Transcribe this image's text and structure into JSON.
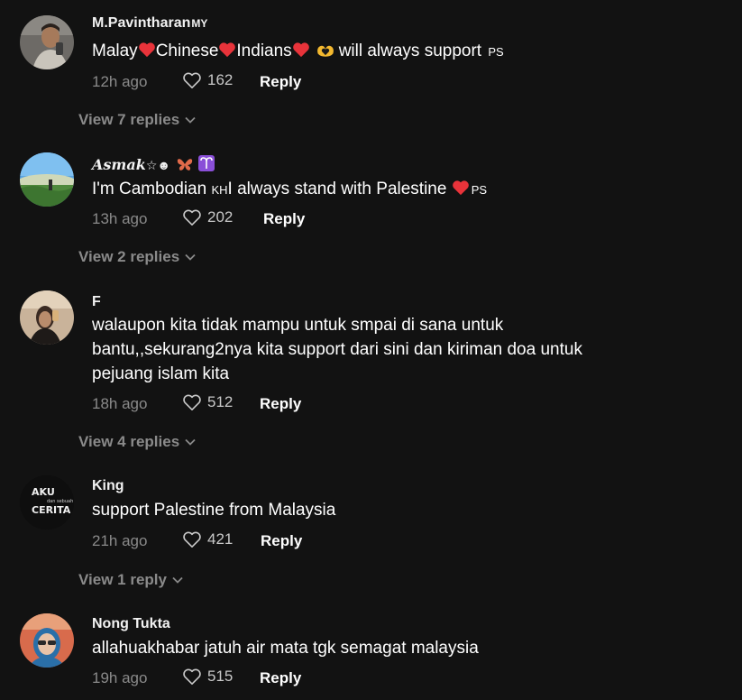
{
  "comments": [
    {
      "username": "M.Pavintharan",
      "username_flag": "MY",
      "text_parts": [
        "Malay",
        "Chinese",
        "Indians",
        "will always support",
        "PS"
      ],
      "time": "12h ago",
      "likes": "162",
      "reply_label": "Reply",
      "view_replies": "View 7 replies"
    },
    {
      "username": "Asmak",
      "username_suffix": "☆☻",
      "text_parts": [
        "I'm Cambodian",
        "KH",
        "I always stand with Palestine",
        "PS"
      ],
      "time": "13h ago",
      "likes": "202",
      "reply_label": "Reply",
      "view_replies": "View 2 replies"
    },
    {
      "username": "F",
      "text": "walaupon kita tidak mampu untuk smpai di sana untuk bantu,,sekurang2nya kita support dari sini dan kiriman doa untuk pejuang islam kita",
      "time": "18h ago",
      "likes": "512",
      "reply_label": "Reply",
      "view_replies": "View 4 replies"
    },
    {
      "username": "King",
      "text": "support Palestine from Malaysia",
      "time": "21h ago",
      "likes": "421",
      "reply_label": "Reply",
      "view_replies": "View 1 reply",
      "avatar_text": [
        "AKU",
        "dan sebuah",
        "CERITA"
      ]
    },
    {
      "username": "Nong Tukta",
      "text": "allahuakhabar jatuh air mata tgk semagat malaysia",
      "time": "19h ago",
      "likes": "515",
      "reply_label": "Reply"
    }
  ],
  "colors": {
    "background": "#121212",
    "muted": "#8a8a8a",
    "heart": "#e0245e"
  }
}
